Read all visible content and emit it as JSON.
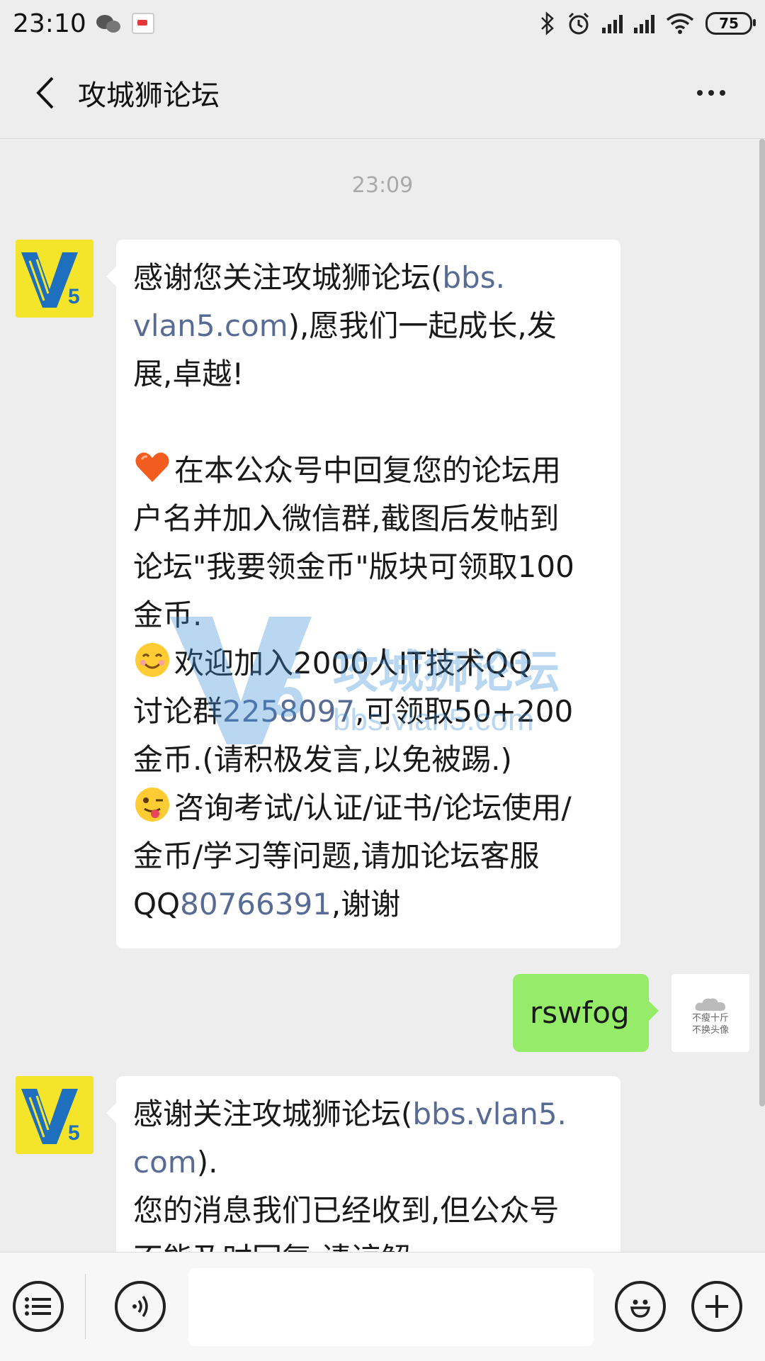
{
  "status_bar": {
    "time": "23:10",
    "battery": "75"
  },
  "header": {
    "title": "攻城狮论坛"
  },
  "chat": {
    "timestamp": "23:09",
    "messages": [
      {
        "lines": [
          {
            "prefix": "感谢您关注攻城狮论坛(",
            "link": "bbs.",
            "suffix": ""
          },
          {
            "prefix": "",
            "link": "vlan5.com",
            "suffix": "),愿我们一起成长,发"
          },
          {
            "prefix": "展,卓越!",
            "link": "",
            "suffix": ""
          },
          {
            "prefix": "",
            "link": "",
            "suffix": ""
          },
          {
            "prefix": "在本公众号中回复您的论坛用",
            "link": "",
            "suffix": "",
            "emoji": "heart-icon"
          },
          {
            "prefix": "户名并加入微信群,截图后发帖到",
            "link": "",
            "suffix": ""
          },
          {
            "prefix": "论坛\"我要领金币\"版块可领取100",
            "link": "",
            "suffix": ""
          },
          {
            "prefix": "金币.",
            "link": "",
            "suffix": ""
          },
          {
            "prefix": "欢迎加入2000人IT技术QQ",
            "link": "",
            "suffix": "",
            "emoji": "smile-icon"
          },
          {
            "prefix": "讨论群",
            "link": "2258097",
            "suffix": ",可领取50+200"
          },
          {
            "prefix": "金币.(请积极发言,以免被踢.)",
            "link": "",
            "suffix": ""
          },
          {
            "prefix": "咨询考试/认证/证书/论坛使用/",
            "link": "",
            "suffix": "",
            "emoji": "wink-tongue-icon"
          },
          {
            "prefix": "金币/学习等问题,请加论坛客服",
            "link": "",
            "suffix": ""
          },
          {
            "prefix": "QQ",
            "link": "80766391",
            "suffix": ",谢谢"
          }
        ]
      },
      {
        "text": "rswfog"
      },
      {
        "lines": [
          {
            "prefix": "感谢关注攻城狮论坛(",
            "link": "bbs.vlan5.",
            "suffix": ""
          },
          {
            "prefix": "",
            "link": "com",
            "suffix": ")."
          },
          {
            "prefix": "您的消息我们已经收到,但公众号",
            "link": "",
            "suffix": ""
          },
          {
            "prefix": "不能及时回复,请谅解.",
            "link": "",
            "suffix": ""
          }
        ]
      }
    ],
    "watermark": {
      "title": "攻城狮论坛",
      "url": "bbs.vlan5.com"
    },
    "user_avatar_text": [
      "不瘦十斤",
      "不换头像"
    ]
  },
  "colors": {
    "link": "#576b95",
    "sent_bubble": "#95ec69",
    "background": "#ededed",
    "avatar_yellow": "#f5e52a"
  }
}
